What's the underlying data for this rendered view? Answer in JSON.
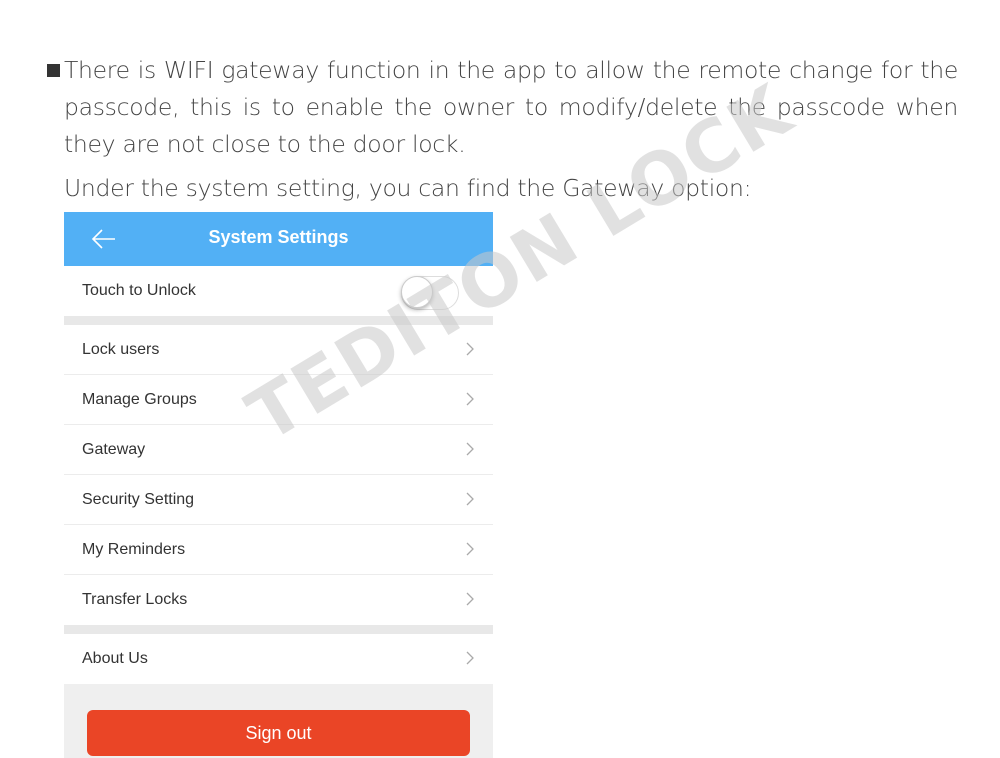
{
  "document": {
    "paragraph1": "There is WIFI gateway function in the app to allow the remote change for the passcode, this is to enable the owner to modify/delete the passcode when they are not close to the door lock.",
    "paragraph2": "Under the system setting, you can find the Gateway option:",
    "watermark": "TEDITON LOCK"
  },
  "app": {
    "header": {
      "title": "System Settings",
      "back_icon": "arrow-left-icon"
    },
    "toggle_row": {
      "label": "Touch to Unlock",
      "enabled": false
    },
    "menu_items": [
      {
        "label": "Lock users"
      },
      {
        "label": "Manage Groups"
      },
      {
        "label": "Gateway"
      },
      {
        "label": "Security Setting"
      },
      {
        "label": "My Reminders"
      },
      {
        "label": "Transfer Locks"
      }
    ],
    "about": {
      "label": "About Us"
    },
    "sign_out_label": "Sign out",
    "colors": {
      "header": "#52b0f5",
      "sign_out": "#ea4526"
    }
  }
}
